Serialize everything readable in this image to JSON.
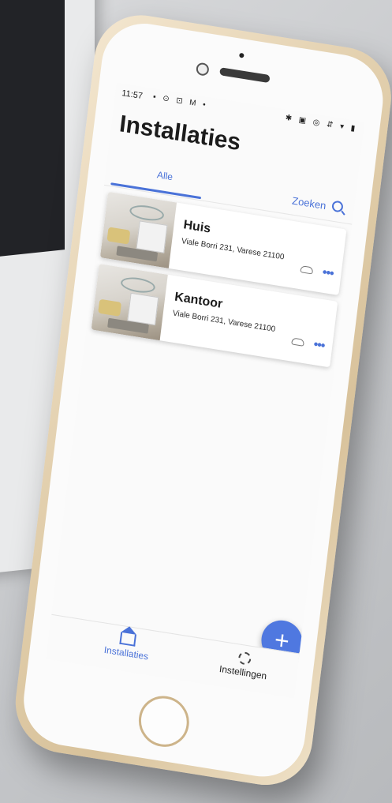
{
  "status_bar": {
    "time": "11:57",
    "left_icons": "▪ ⊙ ⊡ M •",
    "right_icons": "✱ ▣ ◎ ⇵ ▾ ▮"
  },
  "page": {
    "title": "Installaties"
  },
  "tabs": {
    "all_label": "Alle",
    "search_label": "Zoeken"
  },
  "installations": [
    {
      "name": "Huis",
      "address": "Viale Borri 231, Varese 21100"
    },
    {
      "name": "Kantoor",
      "address": "Viale Borri 231, Varese 21100"
    }
  ],
  "card_actions": {
    "more": "•••"
  },
  "fab": {
    "label": "+"
  },
  "bottom_nav": {
    "installations_label": "Installaties",
    "settings_label": "Instellingen"
  },
  "colors": {
    "accent": "#4a72d8",
    "phone_gold": "#e2cfad"
  },
  "icons": [
    "search-icon",
    "cloud-icon",
    "more-icon",
    "home-icon",
    "gear-icon",
    "plus-icon"
  ]
}
